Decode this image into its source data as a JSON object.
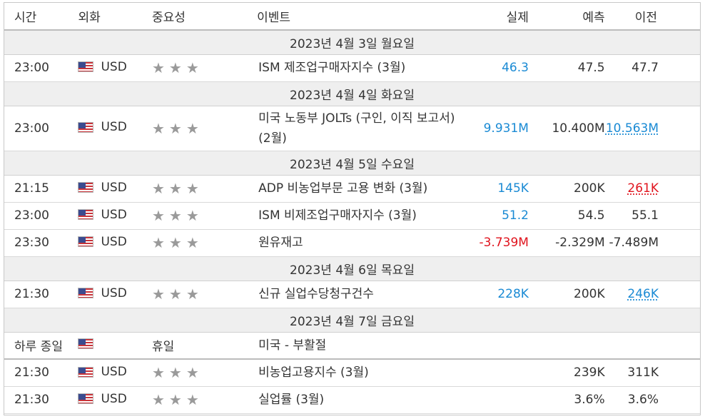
{
  "headers": {
    "time": "시간",
    "currency": "외화",
    "importance": "중요성",
    "event": "이벤트",
    "actual": "실제",
    "forecast": "예측",
    "previous": "이전"
  },
  "colors": {
    "positive": "#1a8ad4",
    "negative": "#e0141e",
    "date_row_bg": "#efefef"
  },
  "star_icon": "★",
  "days": [
    {
      "date": "2023년 4월 3일 월요일",
      "events": [
        {
          "time": "23:00",
          "currency": "USD",
          "event": "ISM 제조업구매자지수 (3월)",
          "actual": "46.3",
          "actual_status": "pos",
          "forecast": "47.5",
          "previous": "47.7",
          "previous_status": ""
        }
      ]
    },
    {
      "date": "2023년 4월 4일 화요일",
      "events": [
        {
          "time": "23:00",
          "currency": "USD",
          "event": "미국 노동부 JOLTs (구인, 이직 보고서) (2월)",
          "actual": "9.931M",
          "actual_status": "pos",
          "forecast": "10.400M",
          "previous": "10.563M",
          "previous_status": "revised-up"
        }
      ]
    },
    {
      "date": "2023년 4월 5일 수요일",
      "events": [
        {
          "time": "21:15",
          "currency": "USD",
          "event": "ADP 비농업부문 고용 변화 (3월)",
          "actual": "145K",
          "actual_status": "pos",
          "forecast": "200K",
          "previous": "261K",
          "previous_status": "revised-down"
        },
        {
          "time": "23:00",
          "currency": "USD",
          "event": "ISM 비제조업구매자지수 (3월)",
          "actual": "51.2",
          "actual_status": "pos",
          "forecast": "54.5",
          "previous": "55.1",
          "previous_status": ""
        },
        {
          "time": "23:30",
          "currency": "USD",
          "event": "원유재고",
          "actual": "-3.739M",
          "actual_status": "neg",
          "forecast": "-2.329M",
          "previous": "-7.489M",
          "previous_status": ""
        }
      ]
    },
    {
      "date": "2023년 4월 6일 목요일",
      "events": [
        {
          "time": "21:30",
          "currency": "USD",
          "event": "신규 실업수당청구건수",
          "actual": "228K",
          "actual_status": "pos",
          "forecast": "200K",
          "previous": "246K",
          "previous_status": "revised-up"
        }
      ]
    },
    {
      "date": "2023년 4월 7일 금요일",
      "holiday": {
        "time": "하루 종일",
        "label": "휴일",
        "event": "미국 - 부활절"
      },
      "events": [
        {
          "time": "21:30",
          "currency": "USD",
          "event": "비농업고용지수 (3월)",
          "actual": "",
          "actual_status": "",
          "forecast": "239K",
          "previous": "311K",
          "previous_status": ""
        },
        {
          "time": "21:30",
          "currency": "USD",
          "event": "실업률 (3월)",
          "actual": "",
          "actual_status": "",
          "forecast": "3.6%",
          "previous": "3.6%",
          "previous_status": ""
        }
      ]
    }
  ]
}
